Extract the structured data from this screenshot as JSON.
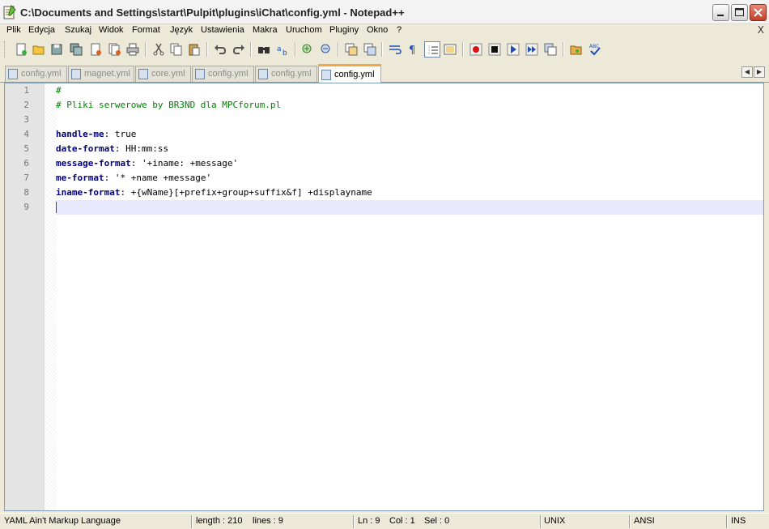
{
  "window": {
    "title": "C:\\Documents and Settings\\start\\Pulpit\\plugins\\iChat\\config.yml - Notepad++",
    "app_icon": "notepad-icon",
    "controls": [
      "minimize-icon",
      "maximize-icon",
      "close-icon"
    ]
  },
  "menu": {
    "items": [
      "Plik",
      "Edycja",
      "Szukaj",
      "Widok",
      "Format",
      "Język",
      "Ustawienia",
      "Makra",
      "Uruchom",
      "Pluginy",
      "Okno",
      "?"
    ],
    "close_glyph": "X"
  },
  "toolbar": {
    "buttons": [
      "new-file-icon",
      "open-file-icon",
      "save-icon",
      "save-all-icon",
      "close-file-icon",
      "close-all-icon",
      "print-icon",
      "cut-icon",
      "copy-icon",
      "paste-icon",
      "undo-icon",
      "redo-icon",
      "find-icon",
      "replace-icon",
      "zoom-in-icon",
      "zoom-out-icon",
      "sync-vertical-icon",
      "sync-horizontal-icon",
      "word-wrap-icon",
      "show-all-chars-icon",
      "indent-guide-icon",
      "user-lang-icon",
      "record-macro-icon",
      "stop-macro-icon",
      "play-macro-icon",
      "run-macro-multiple-icon",
      "save-macro-icon",
      "folder-icon",
      "spellcheck-icon"
    ]
  },
  "tabs": [
    {
      "label": "config.yml",
      "active": false
    },
    {
      "label": "magnet.yml",
      "active": false
    },
    {
      "label": "core.yml",
      "active": false
    },
    {
      "label": "config.yml",
      "active": false
    },
    {
      "label": "config.yml",
      "active": false
    },
    {
      "label": "config.yml",
      "active": true
    }
  ],
  "editor": {
    "lines": [
      {
        "num": "1",
        "parts": [
          {
            "t": "#",
            "c": "comment"
          }
        ]
      },
      {
        "num": "2",
        "parts": [
          {
            "t": "# Pliki serwerowe by BR3ND dla MPCforum.pl",
            "c": "comment"
          }
        ]
      },
      {
        "num": "3",
        "parts": []
      },
      {
        "num": "4",
        "parts": [
          {
            "t": "handle-me",
            "c": "key"
          },
          {
            "t": ": true",
            "c": "val"
          }
        ]
      },
      {
        "num": "5",
        "parts": [
          {
            "t": "date-format",
            "c": "key"
          },
          {
            "t": ": HH:mm:ss",
            "c": "val"
          }
        ]
      },
      {
        "num": "6",
        "parts": [
          {
            "t": "message-format",
            "c": "key"
          },
          {
            "t": ": '+iname: +message'",
            "c": "val"
          }
        ]
      },
      {
        "num": "7",
        "parts": [
          {
            "t": "me-format",
            "c": "key"
          },
          {
            "t": ": '* +name +message'",
            "c": "val"
          }
        ]
      },
      {
        "num": "8",
        "parts": [
          {
            "t": "iname-format",
            "c": "key"
          },
          {
            "t": ": +{wName}[+prefix+group+suffix&f] +displayname",
            "c": "val"
          }
        ]
      },
      {
        "num": "9",
        "parts": []
      }
    ]
  },
  "status": {
    "language": "YAML Ain't Markup Language",
    "length": "length : 210",
    "lines": "lines : 9",
    "ln": "Ln : 9",
    "col": "Col : 1",
    "sel": "Sel : 0",
    "eol": "UNIX",
    "encoding": "ANSI",
    "mode": "INS"
  },
  "colors": {
    "comment": "#008000",
    "key": "#000080",
    "active_tab_accent": "#f7a540",
    "current_line": "#e8e8ff",
    "caret": "#8000ff"
  }
}
